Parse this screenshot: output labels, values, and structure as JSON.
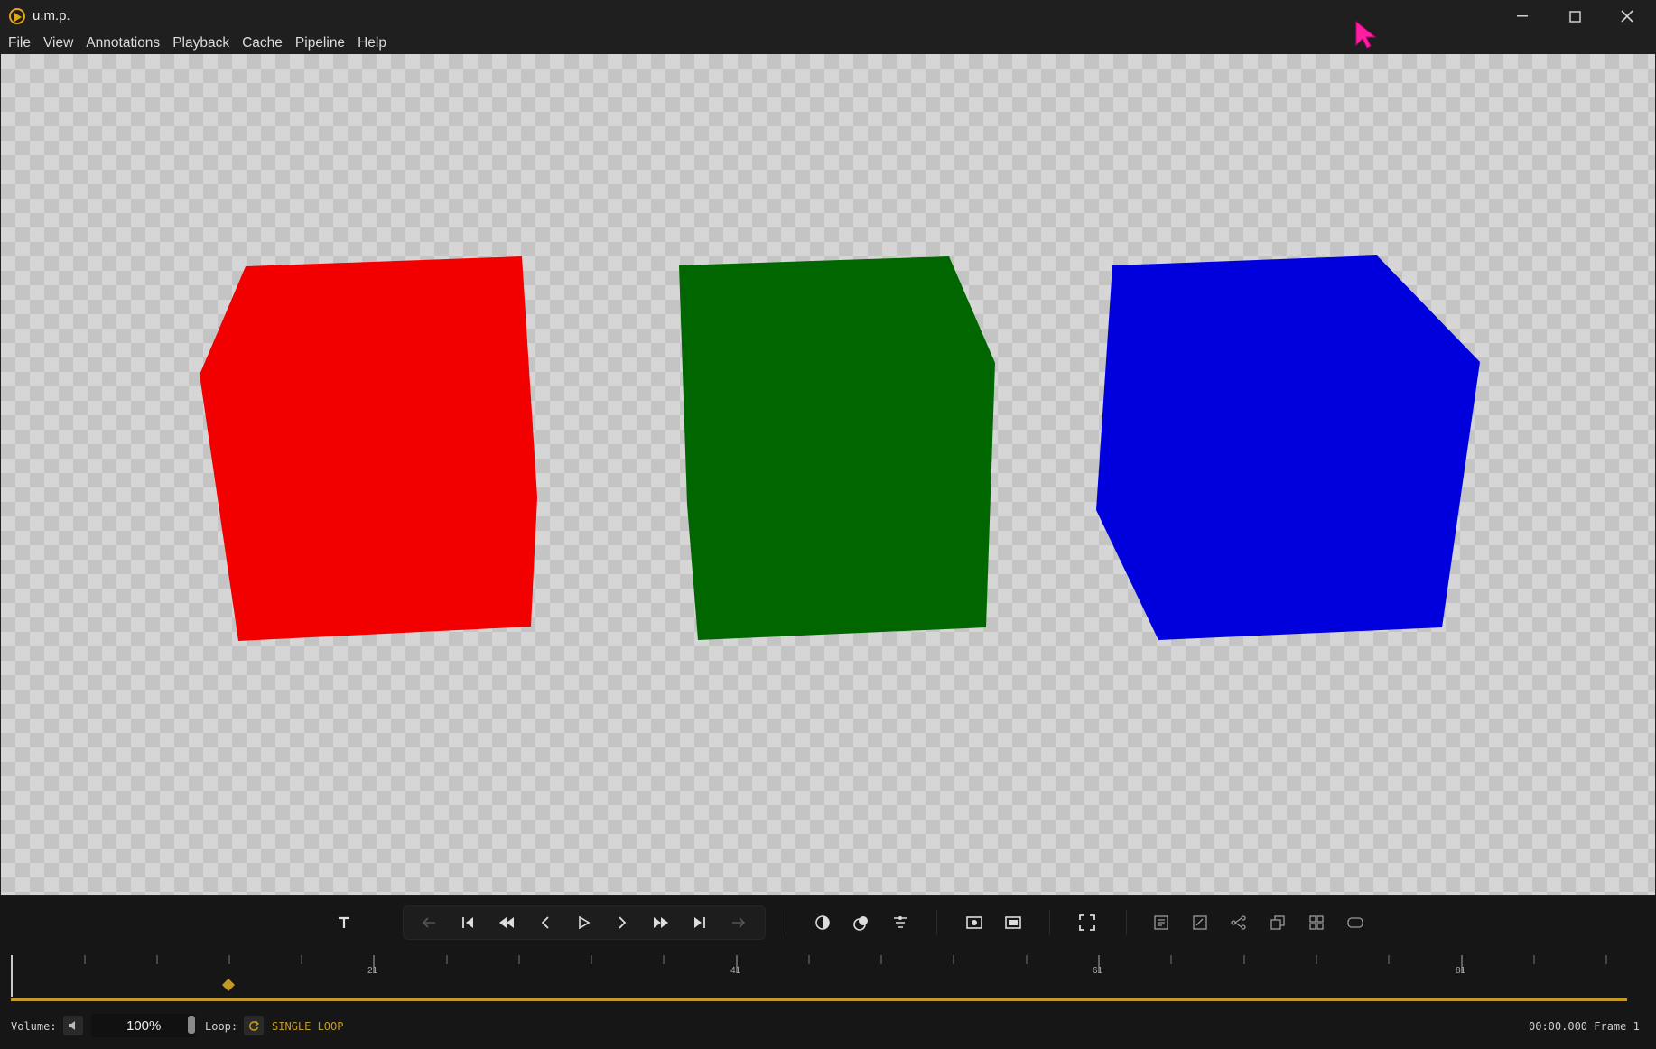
{
  "window": {
    "title": "u.m.p.",
    "icon": "play-circle-icon",
    "controls": [
      "minimize-icon",
      "maximize-icon",
      "close-icon"
    ]
  },
  "menu": {
    "items": [
      "File",
      "View",
      "Annotations",
      "Playback",
      "Cache",
      "Pipeline",
      "Help"
    ]
  },
  "viewer": {
    "background": "transparency-checkerboard",
    "shapes": [
      {
        "name": "red-cube",
        "color": "#f20000"
      },
      {
        "name": "green-cube",
        "color": "#006600"
      },
      {
        "name": "blue-cube",
        "color": "#0000dd"
      }
    ]
  },
  "toolbar": {
    "buttons": [
      "text-tool-icon",
      "undo-arrow-icon",
      "skip-to-start-icon",
      "rewind-icon",
      "step-back-icon",
      "play-icon",
      "step-forward-icon",
      "fast-forward-icon",
      "skip-to-end-icon",
      "redo-arrow-icon",
      "contrast-icon",
      "color-mix-icon",
      "filter-icon",
      "snapshot-icon",
      "safe-area-icon",
      "fullscreen-icon",
      "notes-icon",
      "edit-notes-icon",
      "node-graph-icon",
      "layers-icon",
      "grid-icon",
      "rounded-rect-icon"
    ]
  },
  "timeline": {
    "tick_labels": [
      "21",
      "41",
      "61",
      "81"
    ],
    "keyframe_marker": "keyframe-diamond",
    "accent_color": "#c49a22"
  },
  "status": {
    "volume_label": "Volume:",
    "volume_value": "100%",
    "loop_label": "Loop:",
    "loop_mode": "SINGLE LOOP",
    "timecode": "00:00.000 Frame 1"
  },
  "colors": {
    "accent": "#e0a51c",
    "cursor": "#ff1fa0"
  }
}
